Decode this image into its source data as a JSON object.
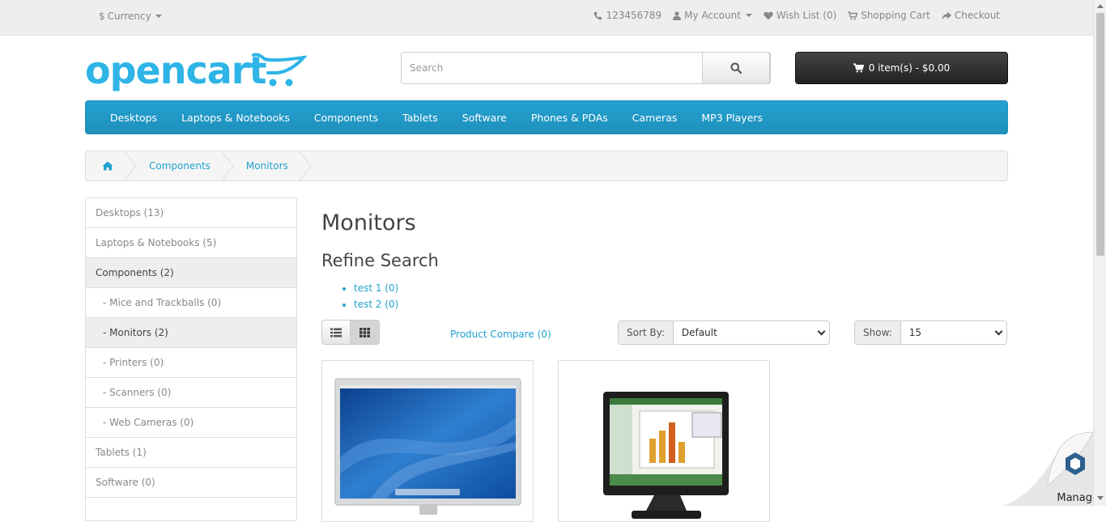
{
  "top_bar": {
    "currency_symbol": "$",
    "currency_label": "Currency",
    "phone": "123456789",
    "my_account": "My Account",
    "wish_list": "Wish List (0)",
    "shopping_cart": "Shopping Cart",
    "checkout": "Checkout"
  },
  "header": {
    "logo_text": "opencart",
    "search_placeholder": "Search",
    "cart_label": "0 item(s) - $0.00"
  },
  "menu": {
    "items": [
      "Desktops",
      "Laptops & Notebooks",
      "Components",
      "Tablets",
      "Software",
      "Phones & PDAs",
      "Cameras",
      "MP3 Players"
    ]
  },
  "breadcrumb": {
    "items": [
      "Components",
      "Monitors"
    ]
  },
  "sidebar": {
    "items": [
      {
        "label": "Desktops (13)"
      },
      {
        "label": "Laptops & Notebooks (5)"
      },
      {
        "label": "Components (2)"
      },
      {
        "label": "- Mice and Trackballs (0)"
      },
      {
        "label": "- Monitors (2)"
      },
      {
        "label": "- Printers (0)"
      },
      {
        "label": "- Scanners (0)"
      },
      {
        "label": "- Web Cameras (0)"
      },
      {
        "label": "Tablets (1)"
      },
      {
        "label": "Software (0)"
      }
    ]
  },
  "content": {
    "title": "Monitors",
    "refine_heading": "Refine Search",
    "refine_links": [
      "test 1 (0)",
      "test 2 (0)"
    ],
    "product_compare": "Product Compare (0)",
    "sort_label": "Sort By:",
    "sort_value": "Default",
    "show_label": "Show:",
    "show_value": "15"
  },
  "widget": {
    "manage_label": "Manage"
  },
  "colors": {
    "accent": "#23a1d1",
    "menu_bg": "#229ac8",
    "cart_bg": "#303030"
  }
}
